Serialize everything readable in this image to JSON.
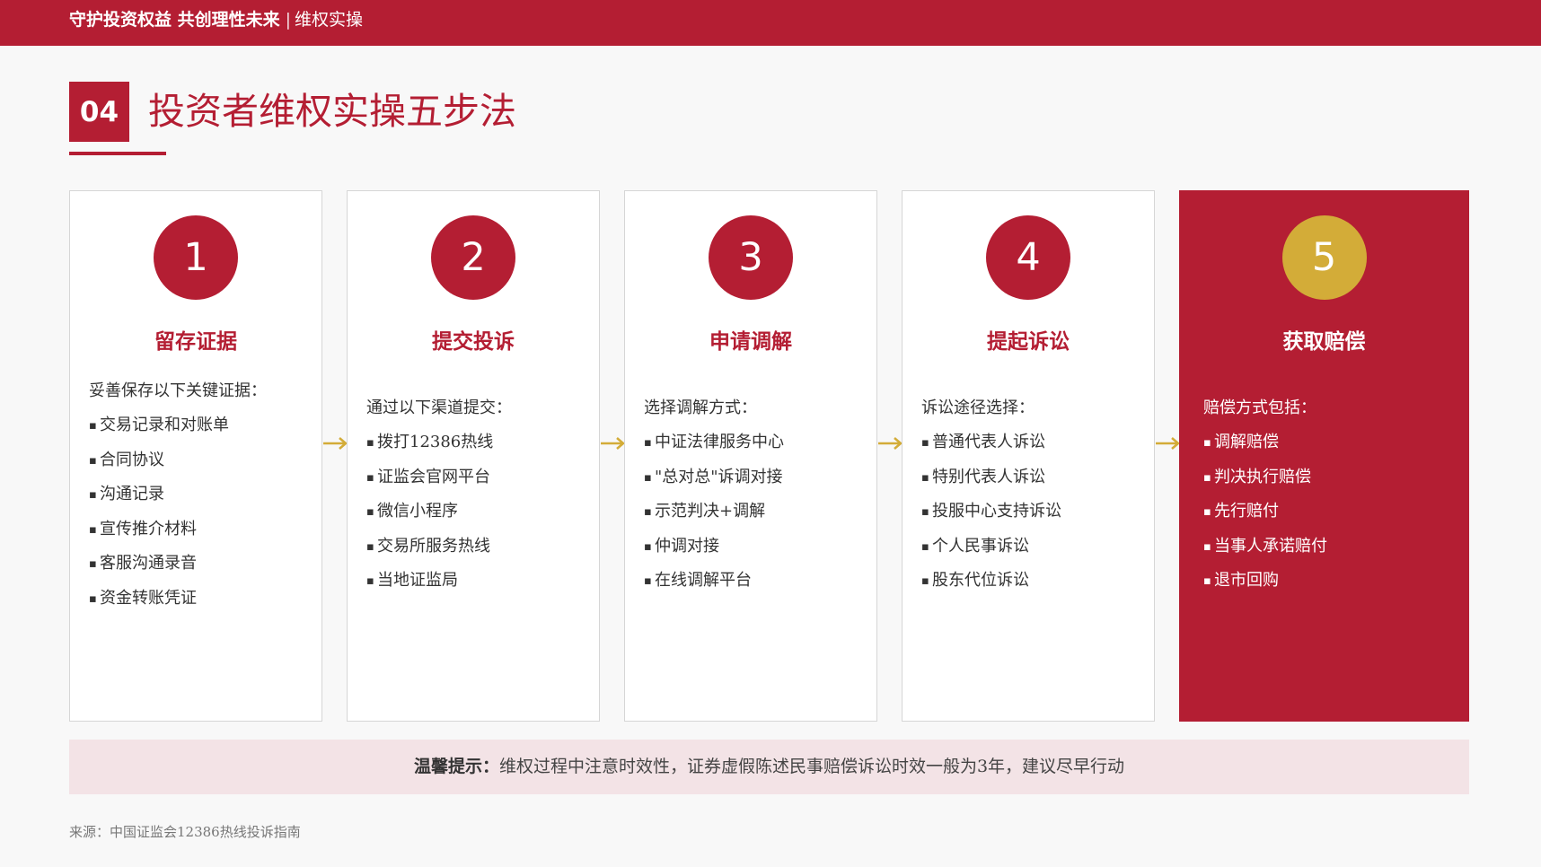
{
  "header": {
    "title": "守护投资权益 共创理性未来",
    "separator": "|",
    "subtitle": "维权实操"
  },
  "section": {
    "number": "04",
    "title": "投资者维权实操五步法"
  },
  "colors": {
    "brand_red": "#b41e33",
    "gold": "#d3ac38",
    "tip_background": "#f3e3e6"
  },
  "steps": [
    {
      "number": "1",
      "title": "留存证据",
      "intro": "妥善保存以下关键证据：",
      "items": [
        "交易记录和对账单",
        "合同协议",
        "沟通记录",
        "宣传推介材料",
        "客服沟通录音",
        "资金转账凭证"
      ]
    },
    {
      "number": "2",
      "title": "提交投诉",
      "intro": "通过以下渠道提交：",
      "items": [
        "拨打12386热线",
        "证监会官网平台",
        "微信小程序",
        "交易所服务热线",
        "当地证监局"
      ]
    },
    {
      "number": "3",
      "title": "申请调解",
      "intro": "选择调解方式：",
      "items": [
        "中证法律服务中心",
        "\"总对总\"诉调对接",
        "示范判决+调解",
        "仲调对接",
        "在线调解平台"
      ]
    },
    {
      "number": "4",
      "title": "提起诉讼",
      "intro": "诉讼途径选择：",
      "items": [
        "普通代表人诉讼",
        "特别代表人诉讼",
        "投服中心支持诉讼",
        "个人民事诉讼",
        "股东代位诉讼"
      ]
    },
    {
      "number": "5",
      "title": "获取赔偿",
      "intro": "赔偿方式包括：",
      "items": [
        "调解赔偿",
        "判决执行赔偿",
        "先行赔付",
        "当事人承诺赔付",
        "退市回购"
      ]
    }
  ],
  "bullet": "▪",
  "tip": {
    "label": "温馨提示：",
    "text": "维权过程中注意时效性，证券虚假陈述民事赔偿诉讼时效一般为3年，建议尽早行动"
  },
  "source": "来源：中国证监会12386热线投诉指南"
}
